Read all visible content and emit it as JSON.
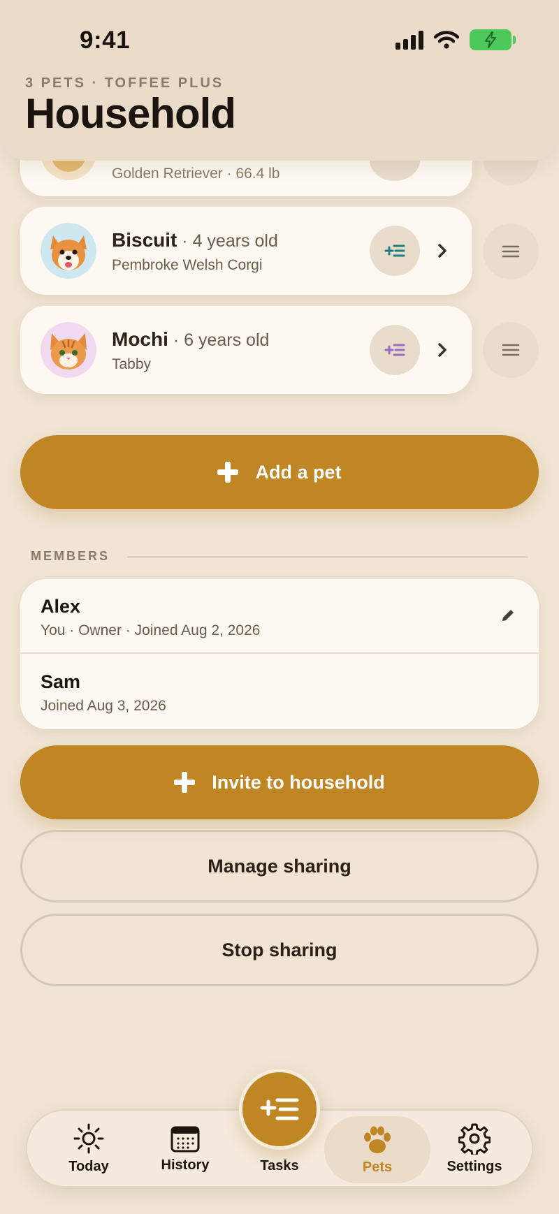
{
  "status_bar": {
    "time": "9:41"
  },
  "header": {
    "subtitle": "3 PETS · TOFFEE PLUS",
    "title": "Household"
  },
  "pets": [
    {
      "name": "",
      "age": "",
      "breed": "Golden Retriever · 66.4 lb",
      "task_accent": "#2f8a8a"
    },
    {
      "name": "Biscuit",
      "age": "4 years old",
      "breed": "Pembroke Welsh Corgi",
      "task_accent": "#1e7f86"
    },
    {
      "name": "Mochi",
      "age": "6 years old",
      "breed": "Tabby",
      "task_accent": "#9a6cc4"
    }
  ],
  "add_pet_label": "Add a pet",
  "members_section": {
    "label": "MEMBERS",
    "members": [
      {
        "name": "Alex",
        "detail": "You · Owner · Joined Aug 2, 2026"
      },
      {
        "name": "Sam",
        "detail": "Joined Aug 3, 2026"
      }
    ]
  },
  "actions": {
    "invite_label": "Invite to household",
    "manage_label": "Manage sharing",
    "stop_label": "Stop sharing"
  },
  "tabbar": {
    "tabs": [
      {
        "label": "Today",
        "icon": "sun-icon"
      },
      {
        "label": "History",
        "icon": "calendar-icon"
      },
      {
        "label": "Tasks",
        "icon": "add-task-icon"
      },
      {
        "label": "Pets",
        "icon": "paw-icon",
        "active": true
      },
      {
        "label": "Settings",
        "icon": "gear-icon"
      }
    ]
  },
  "colors": {
    "accent": "#c08623",
    "background": "#f0e4d3",
    "card": "#fdf9f2"
  }
}
